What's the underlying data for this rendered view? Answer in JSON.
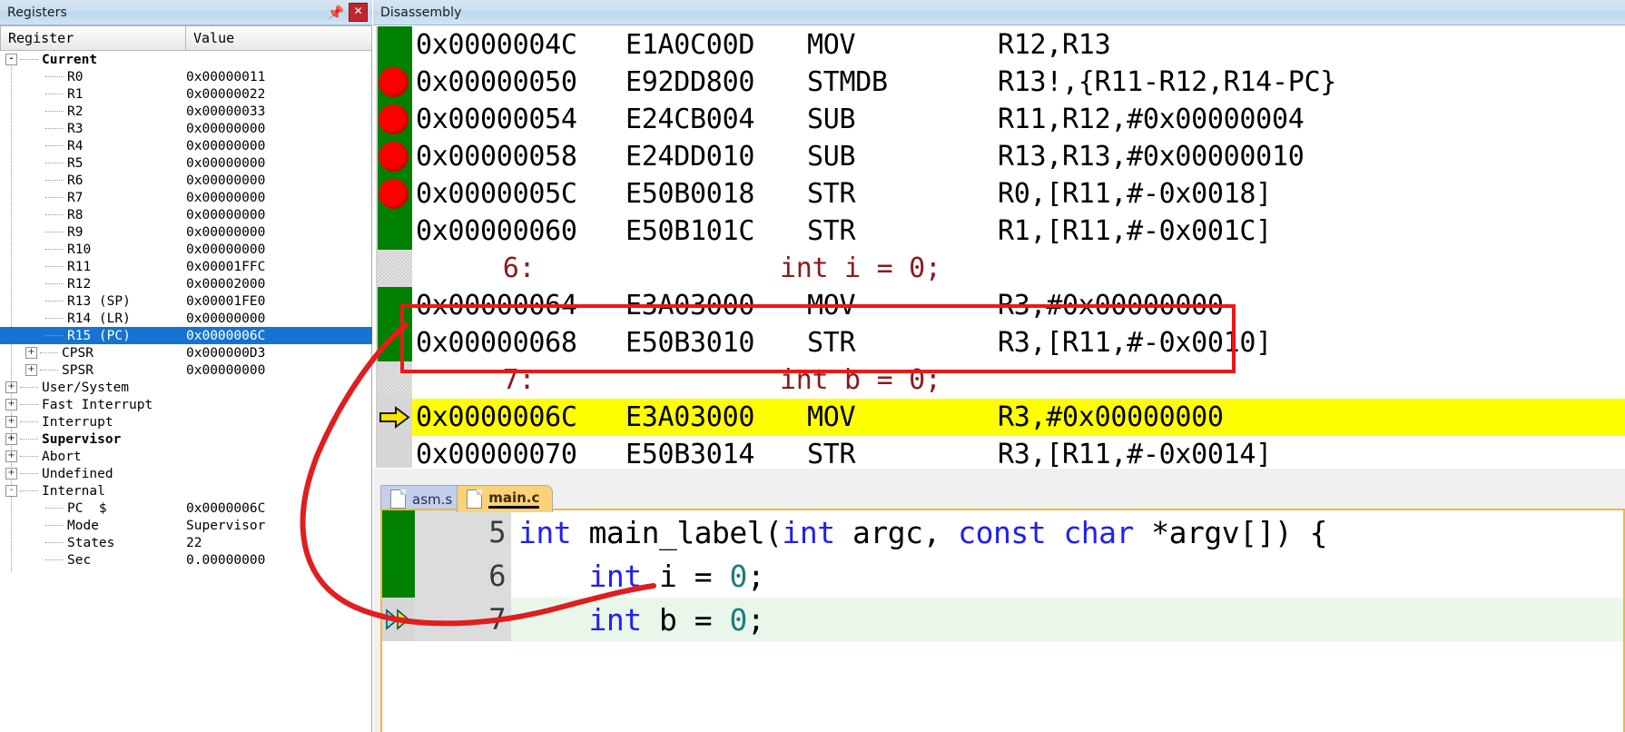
{
  "registers_panel": {
    "title": "Registers",
    "pin_icon": "pin-icon",
    "close_icon": "close-icon",
    "columns": [
      "Register",
      "Value"
    ],
    "rows": [
      {
        "indent": 0,
        "toggle": "-",
        "label": "Current",
        "value": "",
        "bold": true,
        "selected": false
      },
      {
        "indent": 2,
        "toggle": "",
        "label": "R0",
        "value": "0x00000011",
        "bold": false,
        "selected": false
      },
      {
        "indent": 2,
        "toggle": "",
        "label": "R1",
        "value": "0x00000022",
        "bold": false,
        "selected": false
      },
      {
        "indent": 2,
        "toggle": "",
        "label": "R2",
        "value": "0x00000033",
        "bold": false,
        "selected": false
      },
      {
        "indent": 2,
        "toggle": "",
        "label": "R3",
        "value": "0x00000000",
        "bold": false,
        "selected": false
      },
      {
        "indent": 2,
        "toggle": "",
        "label": "R4",
        "value": "0x00000000",
        "bold": false,
        "selected": false
      },
      {
        "indent": 2,
        "toggle": "",
        "label": "R5",
        "value": "0x00000000",
        "bold": false,
        "selected": false
      },
      {
        "indent": 2,
        "toggle": "",
        "label": "R6",
        "value": "0x00000000",
        "bold": false,
        "selected": false
      },
      {
        "indent": 2,
        "toggle": "",
        "label": "R7",
        "value": "0x00000000",
        "bold": false,
        "selected": false
      },
      {
        "indent": 2,
        "toggle": "",
        "label": "R8",
        "value": "0x00000000",
        "bold": false,
        "selected": false
      },
      {
        "indent": 2,
        "toggle": "",
        "label": "R9",
        "value": "0x00000000",
        "bold": false,
        "selected": false
      },
      {
        "indent": 2,
        "toggle": "",
        "label": "R10",
        "value": "0x00000000",
        "bold": false,
        "selected": false
      },
      {
        "indent": 2,
        "toggle": "",
        "label": "R11",
        "value": "0x00001FFC",
        "bold": false,
        "selected": false
      },
      {
        "indent": 2,
        "toggle": "",
        "label": "R12",
        "value": "0x00002000",
        "bold": false,
        "selected": false
      },
      {
        "indent": 2,
        "toggle": "",
        "label": "R13 (SP)",
        "value": "0x00001FE0",
        "bold": false,
        "selected": false
      },
      {
        "indent": 2,
        "toggle": "",
        "label": "R14 (LR)",
        "value": "0x00000000",
        "bold": false,
        "selected": false
      },
      {
        "indent": 2,
        "toggle": "",
        "label": "R15 (PC)",
        "value": "0x0000006C",
        "bold": false,
        "selected": true
      },
      {
        "indent": 1,
        "toggle": "+",
        "label": "CPSR",
        "value": "0x000000D3",
        "bold": false,
        "selected": false
      },
      {
        "indent": 1,
        "toggle": "+",
        "label": "SPSR",
        "value": "0x00000000",
        "bold": false,
        "selected": false
      },
      {
        "indent": 0,
        "toggle": "+",
        "label": "User/System",
        "value": "",
        "bold": false,
        "selected": false
      },
      {
        "indent": 0,
        "toggle": "+",
        "label": "Fast Interrupt",
        "value": "",
        "bold": false,
        "selected": false
      },
      {
        "indent": 0,
        "toggle": "+",
        "label": "Interrupt",
        "value": "",
        "bold": false,
        "selected": false
      },
      {
        "indent": 0,
        "toggle": "+",
        "label": "Supervisor",
        "value": "",
        "bold": true,
        "selected": false
      },
      {
        "indent": 0,
        "toggle": "+",
        "label": "Abort",
        "value": "",
        "bold": false,
        "selected": false
      },
      {
        "indent": 0,
        "toggle": "+",
        "label": "Undefined",
        "value": "",
        "bold": false,
        "selected": false
      },
      {
        "indent": 0,
        "toggle": "-",
        "label": "Internal",
        "value": "",
        "bold": false,
        "selected": false
      },
      {
        "indent": 2,
        "toggle": "",
        "label": "PC  $",
        "value": "0x0000006C",
        "bold": false,
        "selected": false
      },
      {
        "indent": 2,
        "toggle": "",
        "label": "Mode",
        "value": "Supervisor",
        "bold": false,
        "selected": false
      },
      {
        "indent": 2,
        "toggle": "",
        "label": "States",
        "value": "22",
        "bold": false,
        "selected": false
      },
      {
        "indent": 2,
        "toggle": "",
        "label": "Sec",
        "value": "0.00000000",
        "bold": false,
        "selected": false
      }
    ]
  },
  "disassembly_panel": {
    "title": "Disassembly",
    "rows": [
      {
        "kind": "asm",
        "gutter": "green",
        "breakpoint": false,
        "pc": false,
        "highlight": false,
        "address": "0x0000004C",
        "opcode": "E1A0C00D",
        "mnemonic": "MOV",
        "operands": "R12,R13"
      },
      {
        "kind": "asm",
        "gutter": "green",
        "breakpoint": true,
        "pc": false,
        "highlight": false,
        "address": "0x00000050",
        "opcode": "E92DD800",
        "mnemonic": "STMDB",
        "operands": "R13!,{R11-R12,R14-PC}"
      },
      {
        "kind": "asm",
        "gutter": "green",
        "breakpoint": true,
        "pc": false,
        "highlight": false,
        "address": "0x00000054",
        "opcode": "E24CB004",
        "mnemonic": "SUB",
        "operands": "R11,R12,#0x00000004"
      },
      {
        "kind": "asm",
        "gutter": "green",
        "breakpoint": true,
        "pc": false,
        "highlight": false,
        "address": "0x00000058",
        "opcode": "E24DD010",
        "mnemonic": "SUB",
        "operands": "R13,R13,#0x00000010"
      },
      {
        "kind": "asm",
        "gutter": "green",
        "breakpoint": true,
        "pc": false,
        "highlight": false,
        "address": "0x0000005C",
        "opcode": "E50B0018",
        "mnemonic": "STR",
        "operands": "R0,[R11,#-0x0018]"
      },
      {
        "kind": "asm",
        "gutter": "green",
        "breakpoint": false,
        "pc": false,
        "highlight": false,
        "address": "0x00000060",
        "opcode": "E50B101C",
        "mnemonic": "STR",
        "operands": "R1,[R11,#-0x001C]"
      },
      {
        "kind": "src",
        "gutter": "hatch",
        "breakpoint": false,
        "pc": false,
        "highlight": false,
        "line_no": "6:",
        "source": "int i = 0;"
      },
      {
        "kind": "asm",
        "gutter": "green",
        "breakpoint": false,
        "pc": false,
        "highlight": false,
        "address": "0x00000064",
        "opcode": "E3A03000",
        "mnemonic": "MOV",
        "operands": "R3,#0x00000000"
      },
      {
        "kind": "asm",
        "gutter": "green",
        "breakpoint": false,
        "pc": false,
        "highlight": false,
        "address": "0x00000068",
        "opcode": "E50B3010",
        "mnemonic": "STR",
        "operands": "R3,[R11,#-0x0010]"
      },
      {
        "kind": "src",
        "gutter": "hatch",
        "breakpoint": false,
        "pc": false,
        "highlight": false,
        "line_no": "7:",
        "source": "int b = 0;"
      },
      {
        "kind": "asm",
        "gutter": "grey",
        "breakpoint": false,
        "pc": true,
        "highlight": true,
        "address": "0x0000006C",
        "opcode": "E3A03000",
        "mnemonic": "MOV",
        "operands": "R3,#0x00000000"
      },
      {
        "kind": "asm",
        "gutter": "grey",
        "breakpoint": false,
        "pc": false,
        "highlight": false,
        "address": "0x00000070",
        "opcode": "E50B3014",
        "mnemonic": "STR",
        "operands": "R3,[R11,#-0x0014]"
      }
    ],
    "annotation_box_color": "#f01616",
    "annotation_curve_color": "#e11d1d"
  },
  "editor_panel": {
    "tabs": [
      {
        "label": "asm.s",
        "active": false,
        "icon": "file-icon"
      },
      {
        "label": "main.c",
        "active": true,
        "icon": "file-icon"
      }
    ],
    "lines": [
      {
        "number": "5",
        "current": false,
        "marker": "",
        "tokens": [
          {
            "t": "int",
            "c": "kw"
          },
          {
            "t": " main_label(",
            "c": "pl"
          },
          {
            "t": "int",
            "c": "kw"
          },
          {
            "t": " argc, ",
            "c": "pl"
          },
          {
            "t": "const",
            "c": "kw"
          },
          {
            "t": " ",
            "c": "pl"
          },
          {
            "t": "char",
            "c": "kw"
          },
          {
            "t": " *argv[]) {",
            "c": "pl"
          }
        ]
      },
      {
        "number": "6",
        "current": false,
        "marker": "",
        "tokens": [
          {
            "t": "    ",
            "c": "pl"
          },
          {
            "t": "int",
            "c": "kw"
          },
          {
            "t": " i = ",
            "c": "pl"
          },
          {
            "t": "0",
            "c": "num"
          },
          {
            "t": ";",
            "c": "pl"
          }
        ]
      },
      {
        "number": "7",
        "current": true,
        "marker": "double-arrow",
        "tokens": [
          {
            "t": "    ",
            "c": "pl"
          },
          {
            "t": "int",
            "c": "kw"
          },
          {
            "t": " b = ",
            "c": "pl"
          },
          {
            "t": "0",
            "c": "num"
          },
          {
            "t": ";",
            "c": "pl"
          }
        ]
      }
    ]
  },
  "colors": {
    "selection_blue": "#1673d2",
    "breakpoint_red": "#fb0000",
    "pc_highlight_yellow": "#ffff00",
    "gutter_green": "#008000",
    "annotation_red": "#e11d1d",
    "keyword_blue": "#2020f0",
    "number_teal": "#1d7c7c",
    "source_line_maroon": "#8b1a1a",
    "active_tab_yellow": "#fbd27a",
    "inactive_tab_blue": "#c3d0ec"
  }
}
